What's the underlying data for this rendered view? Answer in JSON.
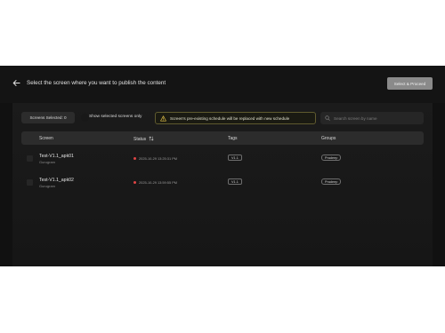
{
  "header": {
    "title": "Select the screen where you want to publish the content",
    "proceed_label": "Select & Proceed"
  },
  "toolbar": {
    "selected_count_label": "Screens Selected: 0",
    "show_selected_label": "Show selected screens only",
    "warning_text": "Screen's pre-existing schedule will be replaced with new schedule",
    "search_placeholder": "Search screen by name"
  },
  "table": {
    "columns": [
      "Screen",
      "Status",
      "Tags",
      "Groups"
    ],
    "rows": [
      {
        "name": "Test-V1.1_apk01",
        "location": "Gurugram",
        "status": "2025-10-29 13:25:31 PM",
        "tag": "V1.1",
        "group": "Pradeep"
      },
      {
        "name": "Test-V1.1_apk02",
        "location": "Gurugram",
        "status": "2025-10-29 13:59:55 PM",
        "tag": "V1.1",
        "group": "Pradeep"
      }
    ]
  },
  "colors": {
    "background": "#111111",
    "panel": "#1b1b1b",
    "button": "#8a8a8a",
    "offline_dot": "#e04545",
    "warning_border": "#5f5a2e"
  }
}
